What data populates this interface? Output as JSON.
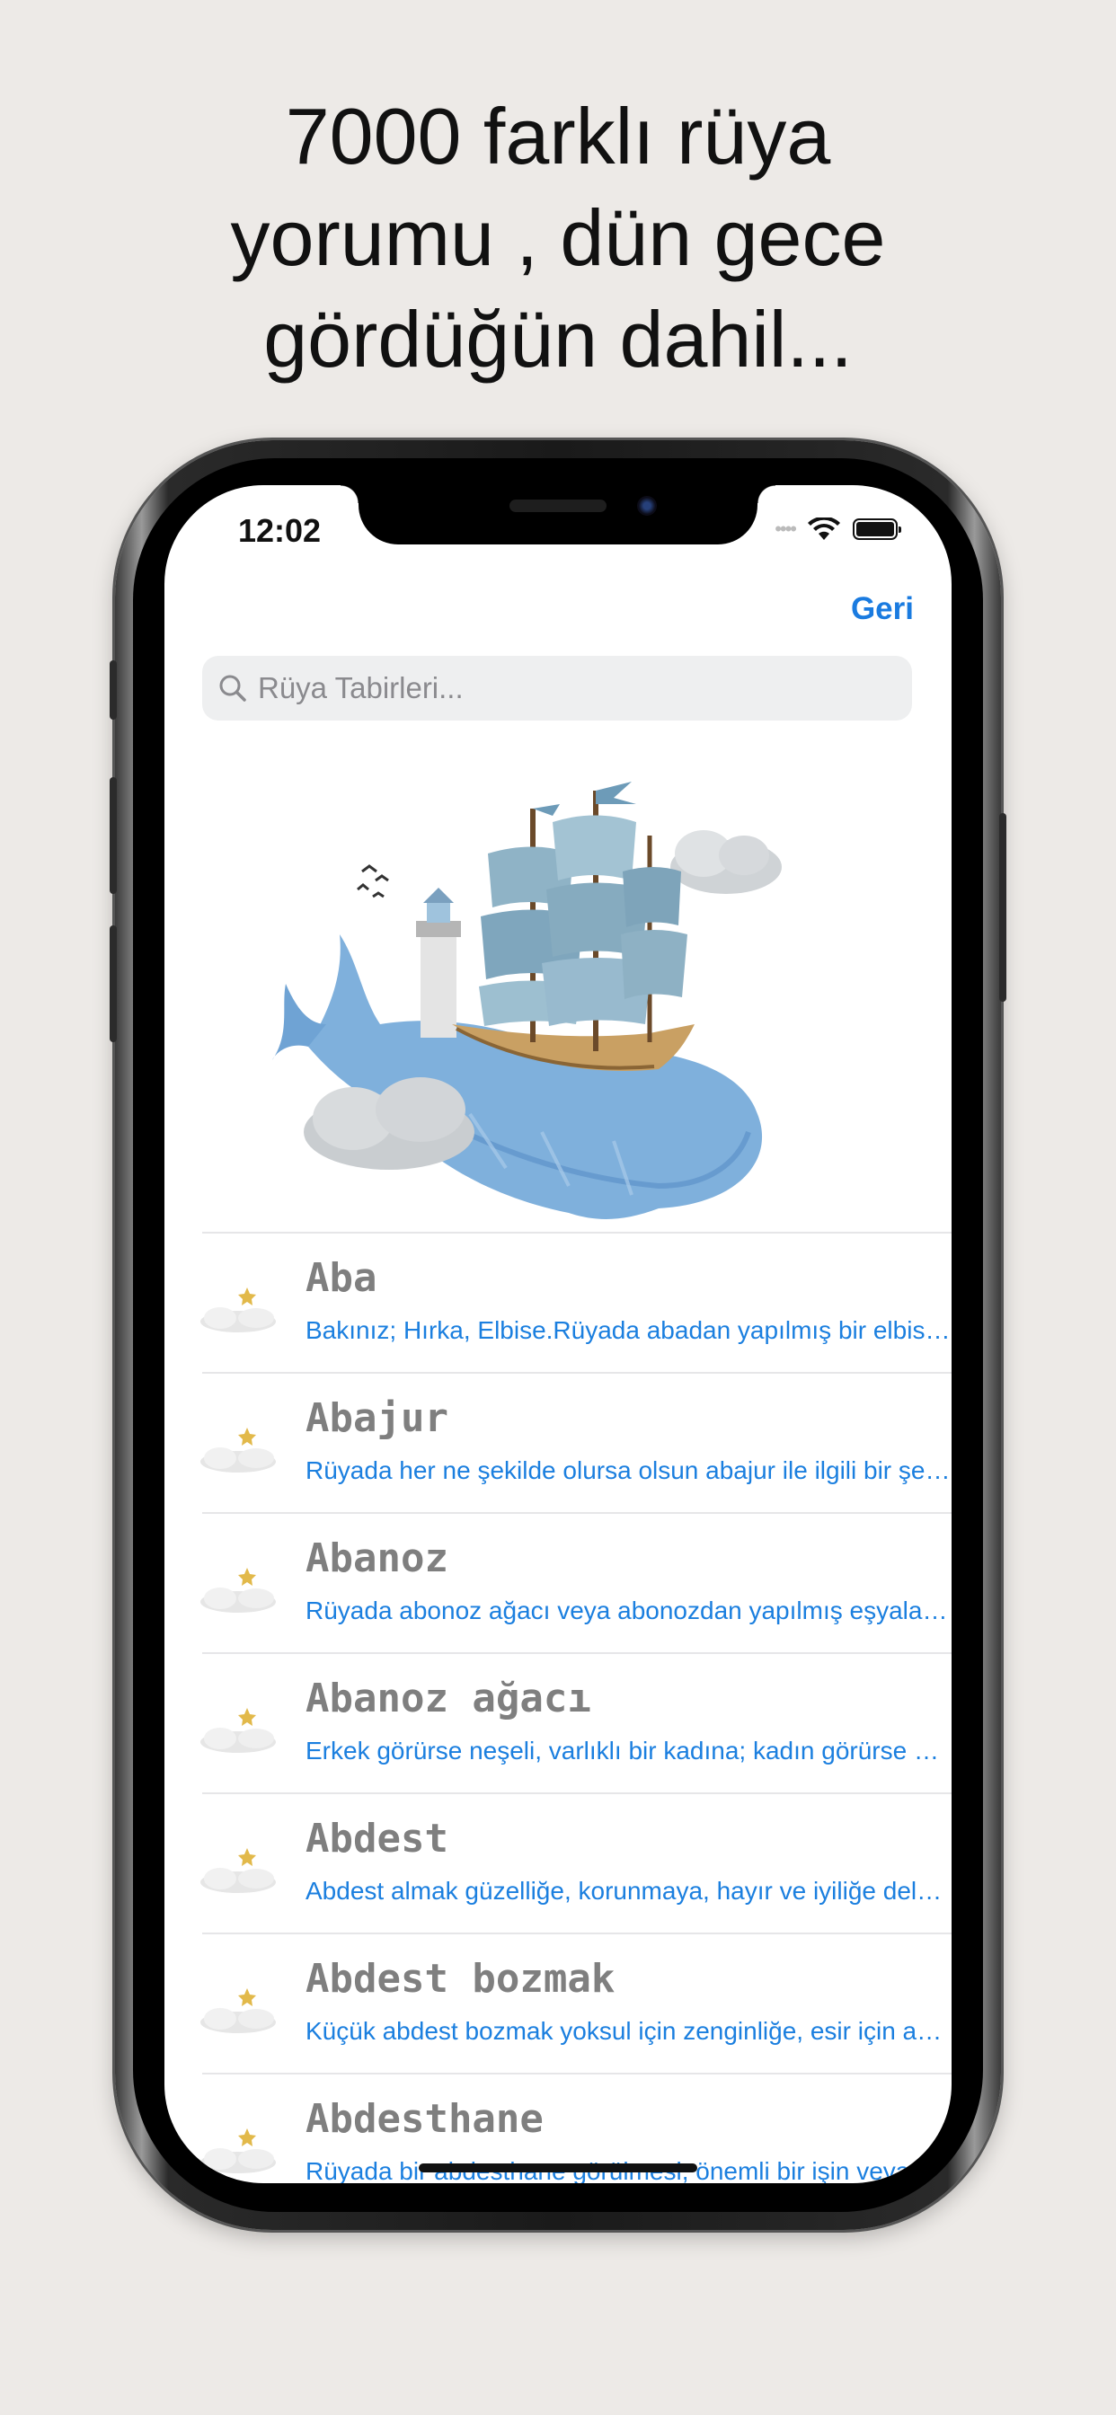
{
  "headline": {
    "line1": "7000 farklı rüya",
    "line2": "yorumu , dün gece",
    "line3": "gördüğün dahil..."
  },
  "status_bar": {
    "time": "12:02"
  },
  "nav": {
    "back_label": "Geri"
  },
  "search": {
    "placeholder": "Rüya Tabirleri...",
    "value": ""
  },
  "colors": {
    "accent": "#1a7be0",
    "title_gray": "#7f7f7f",
    "background": "#edeae7"
  },
  "entries": [
    {
      "title": "Aba",
      "snippet": "Bakınız; Hırka, Elbise.Rüyada abadan yapılmış bir elbise görmek",
      "icon": "crescent-moon-cloud-icon"
    },
    {
      "title": "Abajur",
      "snippet": "Rüyada her ne şekilde olursa olsun abajur ile ilgili bir şey görmek",
      "icon": "crescent-moon-cloud-icon"
    },
    {
      "title": "Abanoz",
      "snippet": "Rüyada abonoz ağacı veya abonozdan yapılmış eşyalar görmek",
      "icon": "crescent-moon-cloud-icon"
    },
    {
      "title": "Abanoz ağacı",
      "snippet": "Erkek görürse neşeli, varlıklı bir kadına; kadın görürse kocasına",
      "icon": "crescent-moon-cloud-icon"
    },
    {
      "title": "Abdest",
      "snippet": "Abdest almak güzelliğe, korunmaya, hayır ve iyiliğe delalet eder",
      "icon": "crescent-moon-cloud-icon"
    },
    {
      "title": "Abdest bozmak",
      "snippet": "Küçük abdest bozmak yoksul için zenginliğe, esir için azatlığa",
      "icon": "crescent-moon-cloud-icon"
    },
    {
      "title": "Abdesthane",
      "snippet": "Rüyada bir abdesthane görülmesi, önemli bir işin veya",
      "icon": "crescent-moon-cloud-icon"
    }
  ]
}
